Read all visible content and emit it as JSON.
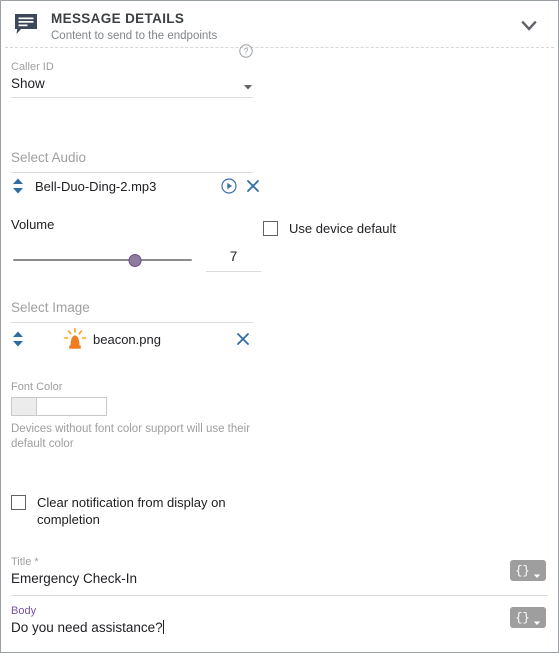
{
  "window": {
    "border_color": "#9aa0a6"
  },
  "header": {
    "icon": "message-bubble-icon",
    "title": "MESSAGE DETAILS",
    "subtitle": "Content to send to the endpoints",
    "collapse_icon": "chevron-down-icon"
  },
  "caller_id": {
    "label": "Caller ID",
    "value": "Show",
    "help_icon": "help-circle-icon",
    "caret_icon": "dropdown-caret-icon"
  },
  "audio": {
    "section_label": "Select Audio",
    "file_name": "Bell-Duo-Ding-2.mp3",
    "sort_icon": "sort-updown-icon",
    "play_icon": "play-circle-icon",
    "remove_icon": "close-x-icon"
  },
  "volume": {
    "label": "Volume",
    "value": "7",
    "min": 0,
    "max": 10,
    "percent": 68,
    "track_color": "#8d8d8d",
    "thumb_color": "#8e7ba0"
  },
  "use_device_default": {
    "label": "Use device default",
    "checked": false
  },
  "image": {
    "section_label": "Select Image",
    "file_name": "beacon.png",
    "sort_icon": "sort-updown-icon",
    "file_icon": "beacon-siren-icon",
    "remove_icon": "close-x-icon"
  },
  "font_color": {
    "label": "Font Color",
    "swatch_color": "#ececec",
    "value": "",
    "placeholder": "",
    "helper_text": "Devices without font color support will use their default color"
  },
  "clear_notification": {
    "label": "Clear notification from display on completion",
    "checked": false
  },
  "title_field": {
    "label": "Title *",
    "value": "Emergency Check-In",
    "token_button_label": "{}",
    "token_caret_icon": "dropdown-caret-icon"
  },
  "body_field": {
    "label": "Body",
    "value": "Do you need assistance?",
    "label_color": "#7b52ab",
    "focused": true,
    "token_button_label": "{}",
    "token_caret_icon": "dropdown-caret-icon"
  }
}
